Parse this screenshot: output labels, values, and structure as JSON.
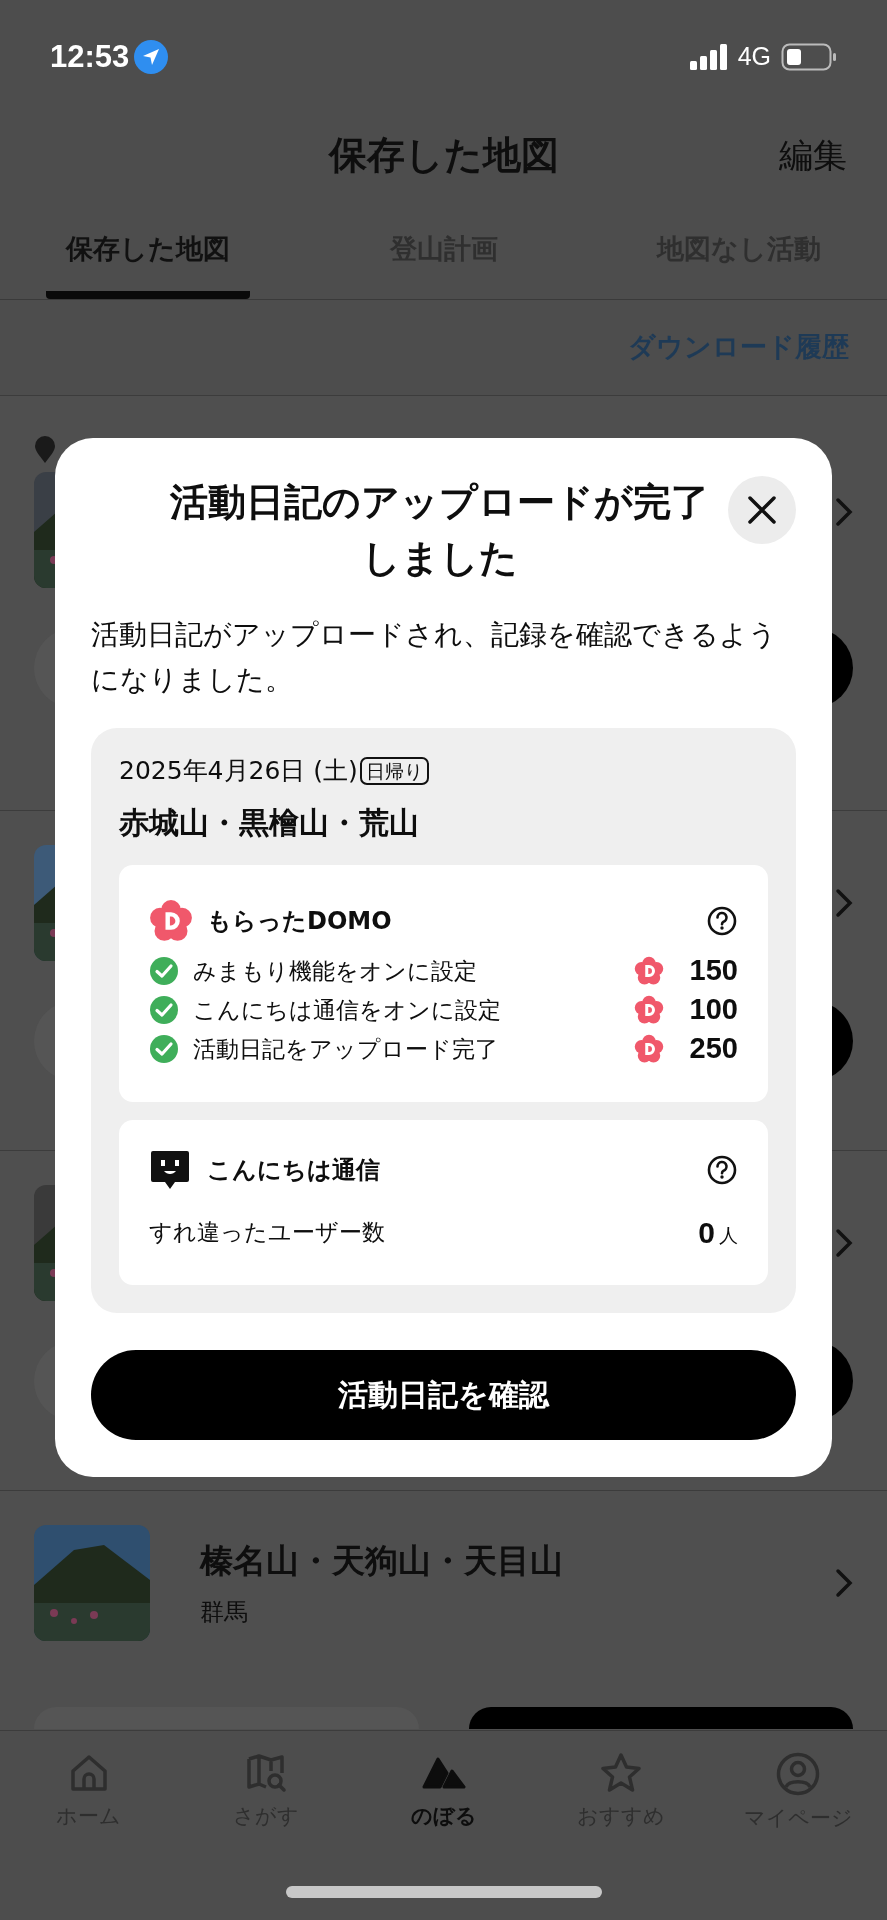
{
  "status_bar": {
    "time": "12:53",
    "network": "4G"
  },
  "header": {
    "title": "保存した地図",
    "edit": "編集"
  },
  "tabs": [
    {
      "label": "保存した地図",
      "selected": true
    },
    {
      "label": "登山計画",
      "selected": false
    },
    {
      "label": "地図なし活動",
      "selected": false
    }
  ],
  "download_history": "ダウンロード履歴",
  "list": {
    "items": [
      {
        "pin": true
      },
      {
        "pin": false
      },
      {
        "pin": false
      },
      {
        "pin": false,
        "title": "榛名山・天狗山・天目山",
        "region": "群馬"
      }
    ]
  },
  "dialog": {
    "title": "活動日記のアップロードが完了しました",
    "message": "活動日記がアップロードされ、記録を確認できるようになりました。",
    "date": "2025年4月26日 (土)",
    "trip_type": "日帰り",
    "mountains": "赤城山・黒檜山・荒山",
    "domo": {
      "title": "もらったDOMO",
      "rows": [
        {
          "label": "みまもり機能をオンに設定",
          "checked": true,
          "points": "150"
        },
        {
          "label": "こんにちは通信をオンに設定",
          "checked": true,
          "points": "100"
        },
        {
          "label": "活動日記をアップロード完了",
          "checked": true,
          "points": "250"
        }
      ]
    },
    "hello": {
      "title": "こんにちは通信",
      "label": "すれ違ったユーザー数",
      "count": "0",
      "unit": "人"
    },
    "button": "活動日記を確認"
  },
  "tab_bar": [
    {
      "label": "ホーム",
      "kind": "home",
      "selected": false
    },
    {
      "label": "さがす",
      "kind": "search",
      "selected": false
    },
    {
      "label": "のぼる",
      "kind": "climb",
      "selected": true
    },
    {
      "label": "おすすめ",
      "kind": "recommended",
      "selected": false
    },
    {
      "label": "マイページ",
      "kind": "mypage",
      "selected": false
    }
  ]
}
